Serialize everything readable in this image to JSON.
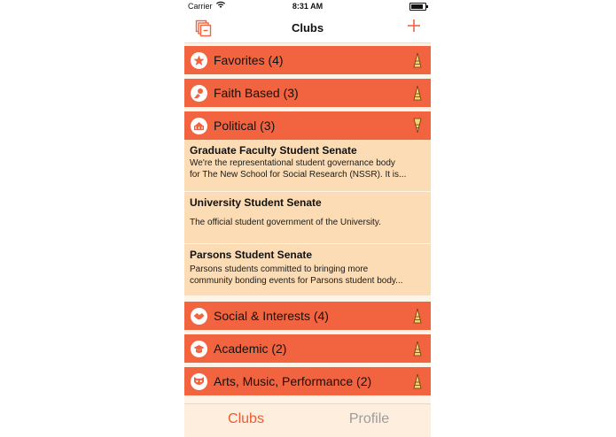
{
  "status_bar": {
    "carrier": "Carrier",
    "time": "8:31 AM"
  },
  "nav": {
    "title": "Clubs"
  },
  "categories": [
    {
      "label": "Favorites (4)",
      "icon": "star-icon"
    },
    {
      "label": "Faith Based (3)",
      "icon": "hand-icon"
    },
    {
      "label": "Political (3)",
      "icon": "political-icon"
    },
    {
      "label": "Social & Interests (4)",
      "icon": "handshake-icon"
    },
    {
      "label": "Academic (2)",
      "icon": "graduation-cap-icon"
    },
    {
      "label": "Arts, Music, Performance (2)",
      "icon": "mask-icon"
    }
  ],
  "clubs": [
    {
      "name": "Graduate Faculty Student Senate",
      "desc_lines": [
        "We're the representational student governance body",
        "for The New School for Social Research (NSSR). It is..."
      ]
    },
    {
      "name": "University Student Senate",
      "desc_lines": [
        "The official student government of the University."
      ]
    },
    {
      "name": "Parsons Student Senate",
      "desc_lines": [
        "Parsons students committed to bringing more",
        "community bonding events for Parsons student body..."
      ]
    }
  ],
  "tabs": {
    "clubs": "Clubs",
    "profile": "Profile"
  },
  "colors": {
    "accent": "#f26440",
    "item_bg": "#fcdcb4",
    "active_tab": "#f05a32",
    "inactive_tab": "#9c9c9c"
  }
}
